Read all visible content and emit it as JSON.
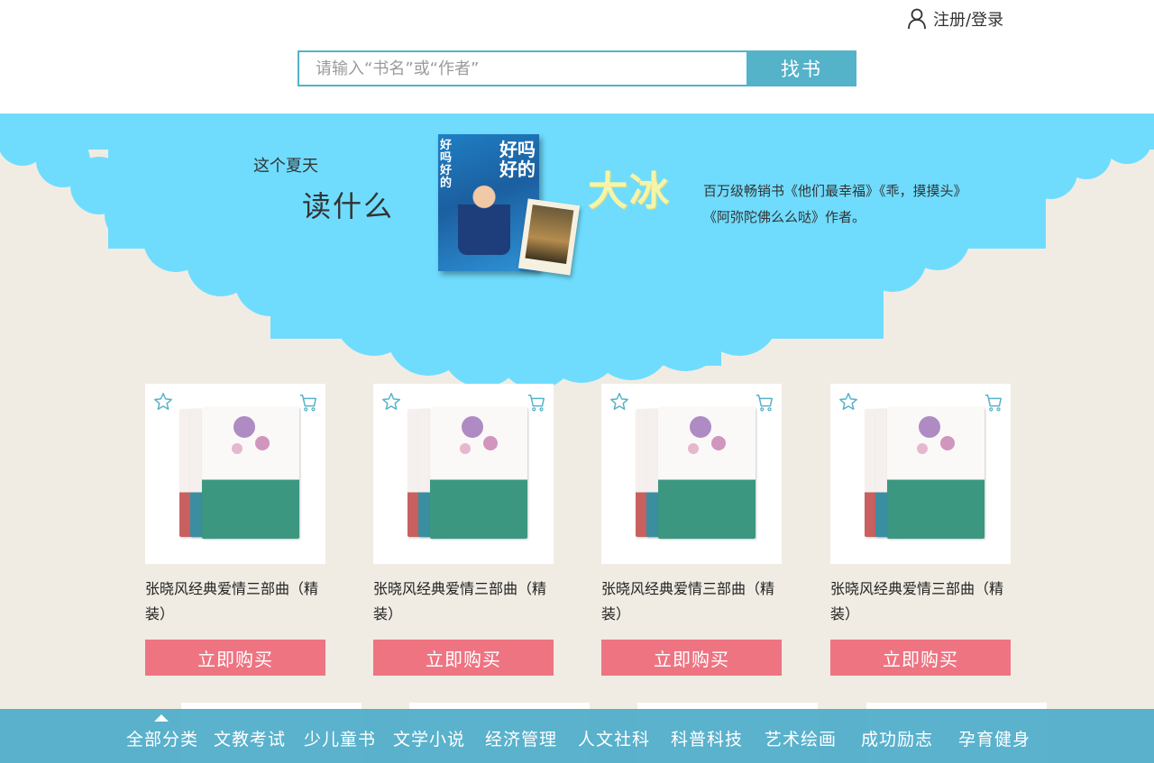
{
  "header": {
    "login_label": "注册/登录",
    "search_placeholder": "请输入“书名”或“作者”",
    "search_button": "找书"
  },
  "banner": {
    "line1": "这个夏天",
    "line2": "读什么",
    "author": "大冰",
    "desc_line1": "百万级畅销书《他们最幸福》《乖，摸摸头》",
    "desc_line2": "《阿弥陀佛么么哒》作者。",
    "book_title": "好吗好的",
    "cloud_color": "#6fdcfd"
  },
  "products": [
    {
      "title": "张晓风经典爱情三部曲（精装）",
      "buy_label": "立即购买"
    },
    {
      "title": "张晓风经典爱情三部曲（精装）",
      "buy_label": "立即购买"
    },
    {
      "title": "张晓风经典爱情三部曲（精装）",
      "buy_label": "立即购买"
    },
    {
      "title": "张晓风经典爱情三部曲（精装）",
      "buy_label": "立即购买"
    }
  ],
  "nav": {
    "items": [
      "全部分类",
      "文教考试",
      "少儿童书",
      "文学小说",
      "经济管理",
      "人文社科",
      "科普科技",
      "艺术绘画",
      "成功励志",
      "孕育健身"
    ],
    "color": "#4eacc9"
  },
  "colors": {
    "accent": "#54b2c9",
    "buy": "#ee7482",
    "background": "#f0ece3"
  }
}
